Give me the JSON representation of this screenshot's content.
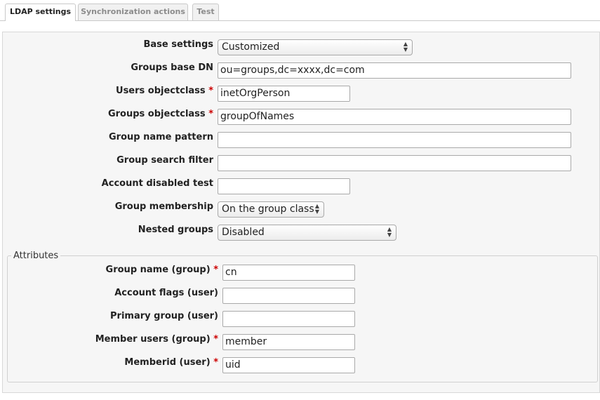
{
  "tabs": [
    {
      "label": "LDAP settings",
      "active": true
    },
    {
      "label": "Synchronization actions",
      "active": false
    },
    {
      "label": "Test",
      "active": false
    }
  ],
  "form": {
    "base_settings": {
      "label": "Base settings",
      "value": "Customized"
    },
    "groups_base_dn": {
      "label": "Groups base DN",
      "value": "ou=groups,dc=xxxx,dc=com"
    },
    "users_objectclass": {
      "label": "Users objectclass",
      "value": "inetOrgPerson",
      "required": true
    },
    "groups_objectclass": {
      "label": "Groups objectclass",
      "value": "groupOfNames",
      "required": true
    },
    "group_name_pattern": {
      "label": "Group name pattern",
      "value": ""
    },
    "group_search_filter": {
      "label": "Group search filter",
      "value": ""
    },
    "account_disabled_test": {
      "label": "Account disabled test",
      "value": ""
    },
    "group_membership": {
      "label": "Group membership",
      "value": "On the group class"
    },
    "nested_groups": {
      "label": "Nested groups",
      "value": "Disabled"
    }
  },
  "attributes": {
    "legend": "Attributes",
    "group_name": {
      "label": "Group name (group)",
      "value": "cn",
      "required": true
    },
    "account_flags": {
      "label": "Account flags (user)",
      "value": ""
    },
    "primary_group": {
      "label": "Primary group (user)",
      "value": ""
    },
    "member_users": {
      "label": "Member users (group)",
      "value": "member",
      "required": true
    },
    "memberid": {
      "label": "Memberid (user)",
      "value": "uid",
      "required": true
    }
  },
  "required_marker": "*",
  "colors": {
    "required": "#cc0000",
    "panel_bg": "#f6f6f6",
    "border": "#a9a9a9"
  }
}
